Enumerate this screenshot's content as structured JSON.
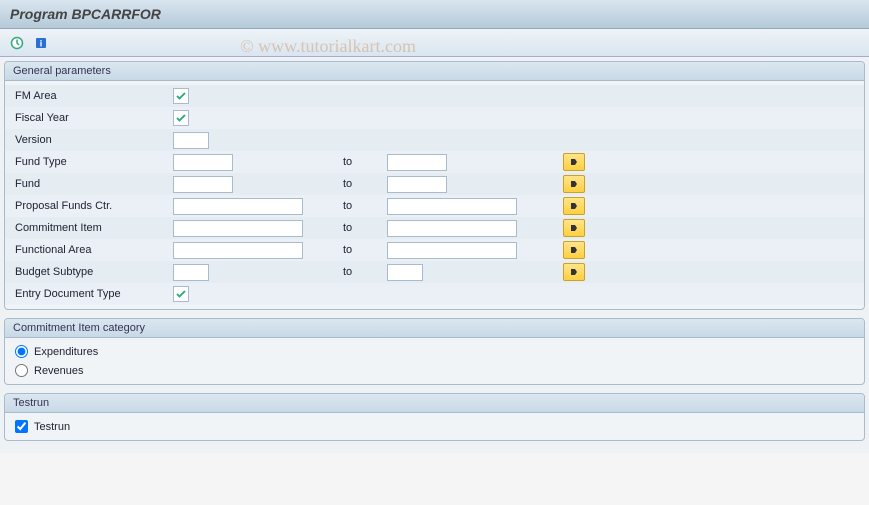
{
  "title": "Program BPCARRFOR",
  "watermark": "© www.tutorialkart.com",
  "toolbar": {
    "execute_tooltip": "Execute",
    "info_tooltip": "Information"
  },
  "groups": {
    "general": {
      "title": "General parameters",
      "rows": {
        "fm_area": {
          "label": "FM Area",
          "required": true
        },
        "fiscal_year": {
          "label": "Fiscal Year",
          "required": true
        },
        "version": {
          "label": "Version",
          "value": ""
        },
        "fund_type": {
          "label": "Fund Type",
          "from": "",
          "to_label": "to",
          "to": ""
        },
        "fund": {
          "label": "Fund",
          "from": "",
          "to_label": "to",
          "to": ""
        },
        "proposal_funds_ctr": {
          "label": "Proposal Funds Ctr.",
          "from": "",
          "to_label": "to",
          "to": ""
        },
        "commitment_item": {
          "label": "Commitment Item",
          "from": "",
          "to_label": "to",
          "to": ""
        },
        "functional_area": {
          "label": "Functional Area",
          "from": "",
          "to_label": "to",
          "to": ""
        },
        "budget_subtype": {
          "label": "Budget Subtype",
          "from": "",
          "to_label": "to",
          "to": ""
        },
        "entry_doc_type": {
          "label": "Entry Document Type",
          "required": true
        }
      }
    },
    "citem_cat": {
      "title": "Commitment Item category",
      "options": {
        "expenditures": {
          "label": "Expenditures",
          "checked": true
        },
        "revenues": {
          "label": "Revenues",
          "checked": false
        }
      }
    },
    "testrun": {
      "title": "Testrun",
      "checkbox": {
        "label": "Testrun",
        "checked": true
      }
    }
  }
}
